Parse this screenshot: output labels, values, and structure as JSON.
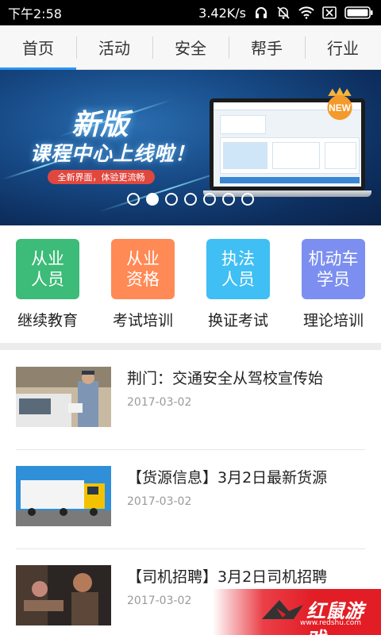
{
  "status_bar": {
    "time": "下午2:58",
    "net_speed": "3.42K/s"
  },
  "tabs": [
    {
      "label": "首页",
      "active": true
    },
    {
      "label": "活动",
      "active": false
    },
    {
      "label": "安全",
      "active": false
    },
    {
      "label": "帮手",
      "active": false
    },
    {
      "label": "行业",
      "active": false
    }
  ],
  "banner": {
    "headline": "新版",
    "subheadline": "课程中心上线啦！",
    "pill_text": "全新界面，体验更流畅",
    "badge": "NEW",
    "carousel_pages": 7,
    "carousel_active_index": 1
  },
  "categories": [
    {
      "tile_line1": "从业",
      "tile_line2": "人员",
      "label": "继续教育",
      "color": "#3dbb78"
    },
    {
      "tile_line1": "从业",
      "tile_line2": "资格",
      "label": "考试培训",
      "color": "#ff8a55"
    },
    {
      "tile_line1": "执法",
      "tile_line2": "人员",
      "label": "换证考试",
      "color": "#3fbff3"
    },
    {
      "tile_line1": "机动车",
      "tile_line2": "学员",
      "label": "理论培训",
      "color": "#7c8ff0"
    }
  ],
  "news": [
    {
      "title": "荆门：交通安全从驾校宣传始",
      "date": "2017-03-02",
      "thumb": "police-officer-photo"
    },
    {
      "title": "【货源信息】3月2日最新货源",
      "date": "2017-03-02",
      "thumb": "yellow-truck-photo"
    },
    {
      "title": "【司机招聘】3月2日司机招聘",
      "date": "2017-03-02",
      "thumb": "truck-driver-photo"
    }
  ],
  "watermark": {
    "text": "红鼠游戏",
    "url": "www.redshu.com"
  },
  "colors": {
    "accent": "#2e95f0",
    "date_gray": "#9a9a9a"
  }
}
